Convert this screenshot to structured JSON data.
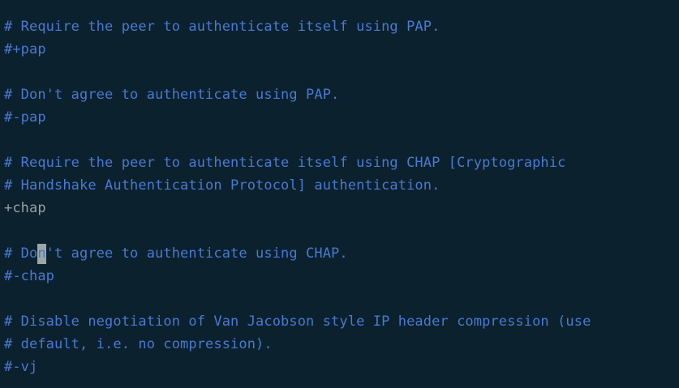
{
  "editor": {
    "colors": {
      "background": "#0b212e",
      "comment": "#4a79d0",
      "plain": "#93a1a1",
      "cursor": "#9aa7a3"
    },
    "lines": [
      {
        "text": "# Require the peer to authenticate itself using PAP.",
        "kind": "comment"
      },
      {
        "text": "#+pap",
        "kind": "comment"
      },
      {
        "text": "",
        "kind": "blank"
      },
      {
        "text": "# Don't agree to authenticate using PAP.",
        "kind": "comment"
      },
      {
        "text": "#-pap",
        "kind": "comment"
      },
      {
        "text": "",
        "kind": "blank"
      },
      {
        "text": "# Require the peer to authenticate itself using CHAP [Cryptographic",
        "kind": "comment"
      },
      {
        "text": "# Handshake Authentication Protocol] authentication.",
        "kind": "comment"
      },
      {
        "text": "+chap",
        "kind": "plain"
      },
      {
        "text": "",
        "kind": "cursor"
      },
      {
        "text": "# Don't agree to authenticate using CHAP.",
        "kind": "comment"
      },
      {
        "text": "#-chap",
        "kind": "comment"
      },
      {
        "text": "",
        "kind": "blank"
      },
      {
        "text": "# Disable negotiation of Van Jacobson style IP header compression (use",
        "kind": "comment"
      },
      {
        "text": "# default, i.e. no compression).",
        "kind": "comment"
      },
      {
        "text": "#-vj",
        "kind": "comment"
      }
    ]
  }
}
